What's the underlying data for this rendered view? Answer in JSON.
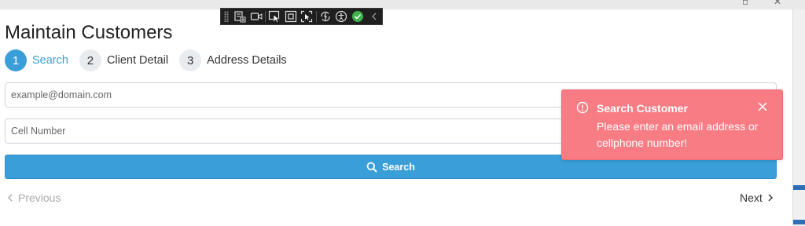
{
  "page": {
    "title": "Maintain Customers"
  },
  "steps": [
    {
      "number": "1",
      "label": "Search",
      "active": true
    },
    {
      "number": "2",
      "label": "Client Detail",
      "active": false
    },
    {
      "number": "3",
      "label": "Address Details",
      "active": false
    }
  ],
  "form": {
    "email_placeholder": "example@domain.com",
    "email_value": "",
    "cell_placeholder": "Cell Number",
    "cell_value": "",
    "search_label": "Search"
  },
  "nav": {
    "previous_label": "Previous",
    "next_label": "Next"
  },
  "toast": {
    "title": "Search Customer",
    "message": "Please enter an email address or cellphone number!",
    "color": "#f87c84"
  },
  "colors": {
    "accent": "#3a9fd8",
    "toast_bg": "#f87c84"
  },
  "debug_toolbar": {
    "icons": [
      "live-tree-icon",
      "record-icon",
      "select-element-icon",
      "display-layout-adorners-icon",
      "track-focus-icon",
      "hot-reload-icon",
      "accessibility-icon",
      "status-ok-icon",
      "collapse-icon"
    ]
  }
}
